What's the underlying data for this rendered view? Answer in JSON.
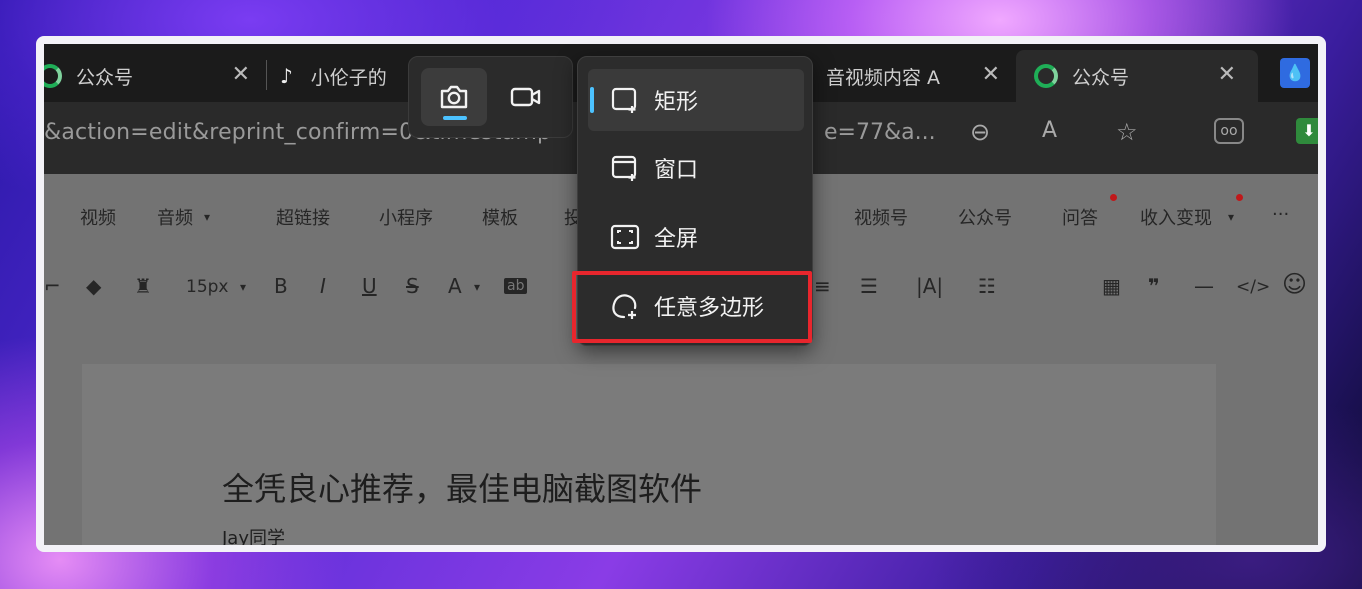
{
  "browser": {
    "tabs": [
      {
        "label": "公众号",
        "icon": "wechat-icon",
        "active": false
      },
      {
        "label": "小伦子的",
        "icon": "tiktok-icon",
        "active": false
      },
      {
        "label": "音视频内容 A",
        "icon": "",
        "active": false
      },
      {
        "label": "公众号",
        "icon": "wechat-icon",
        "active": true
      }
    ],
    "url_left": "&action=edit&reprint_confirm=0&timestamp=",
    "url_right": "e=77&a...",
    "close_glyph": "✕"
  },
  "editor": {
    "menu": [
      "视频",
      "音频",
      "超链接",
      "小程序",
      "模板",
      "投",
      "视频号",
      "公众号",
      "问答",
      "收入变现",
      "···"
    ],
    "toolbar": {
      "font_size": "15px",
      "bold": "B",
      "italic": "I",
      "underline": "U",
      "strike": "S",
      "font_color": "A",
      "ab": "ab"
    },
    "article_title": "全凭良心推荐，最佳电脑截图软件",
    "author": "Jay同学"
  },
  "snip": {
    "modes": [
      {
        "name": "screenshot",
        "icon": "camera-icon",
        "active": true
      },
      {
        "name": "record",
        "icon": "video-camera-icon",
        "active": false
      }
    ],
    "options": [
      {
        "label": "矩形",
        "icon": "rectangle-snip-icon",
        "selected": true
      },
      {
        "label": "窗口",
        "icon": "window-snip-icon",
        "selected": false
      },
      {
        "label": "全屏",
        "icon": "fullscreen-snip-icon",
        "selected": false
      },
      {
        "label": "任意多边形",
        "icon": "freeform-snip-icon",
        "selected": false,
        "highlighted": true
      }
    ]
  },
  "colors": {
    "accent": "#4cc2ff",
    "highlight_border": "#e8262d",
    "wechat_green": "#1fae57"
  }
}
